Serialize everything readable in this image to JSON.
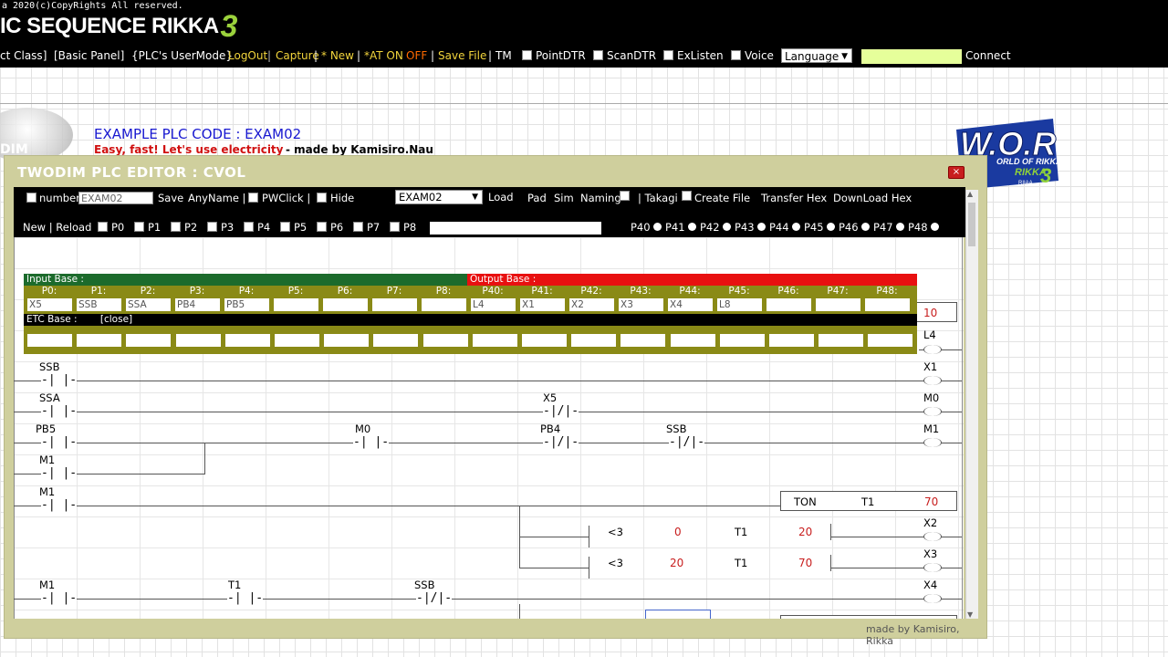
{
  "banner": {
    "copyright": "a 2020(c)CopyRights All reserved.",
    "logo_text": "IC SEQUENCE RIKKA",
    "logo_number": "3"
  },
  "menubar": {
    "items": [
      {
        "label": "ct Class]"
      },
      {
        "label": "[Basic Panel]"
      },
      {
        "label": "{PLC's UserMode}"
      },
      {
        "label": "LogOut"
      },
      {
        "label": "Capture"
      },
      {
        "label": "|"
      },
      {
        "label": "* New"
      },
      {
        "label": "|"
      },
      {
        "label": "*AT ON"
      },
      {
        "label": "OFF"
      },
      {
        "label": "|"
      },
      {
        "label": "Save File"
      },
      {
        "label": "|"
      },
      {
        "label": "TM"
      }
    ],
    "checks": [
      {
        "label": "PointDTR"
      },
      {
        "label": "ScanDTR"
      },
      {
        "label": "ExListen"
      },
      {
        "label": "Voice"
      }
    ],
    "language_value": "Language",
    "connect_label": "Connect"
  },
  "example": {
    "disc_text": "DIM",
    "title": "EXAMPLE PLC CODE : EXAM02",
    "subtitle": "Easy, fast! Let's use electricity",
    "author": "- made by Kamisiro.Nau"
  },
  "wor_logo": {
    "text": "W.O.R",
    "sub": "ORLD OF RIKKA",
    "brand": "RIKKA",
    "num": "3",
    "small": "RIIAA"
  },
  "editor": {
    "title": "TWODIM PLC EDITOR : CVOL",
    "close_icon": "×",
    "footer": "made by Kamisiro, Rikka",
    "toolbar": {
      "number_label": "number",
      "number_value": "EXAM02",
      "save": "Save",
      "anyname": "AnyName |",
      "pwclick": "PWClick |",
      "hide": "Hide",
      "file_value": "EXAM02",
      "load": "Load",
      "pad": "Pad",
      "sim": "Sim",
      "naming": "Naming",
      "takagi": "| Takagi",
      "create_file": "Create File",
      "transfer_hex": "Transfer Hex",
      "download_hex": "DownLoad Hex",
      "new_reload": "New | Reload",
      "p_checks": [
        "P0",
        "P1",
        "P2",
        "P3",
        "P4",
        "P5",
        "P6",
        "P7",
        "P8"
      ],
      "p_radios": [
        "P40",
        "P41",
        "P42",
        "P43",
        "P44",
        "P45",
        "P46",
        "P47",
        "P48"
      ]
    },
    "io": {
      "input_base": "Input Base :",
      "output_base": "Output Base :",
      "etc_base": "ETC Base :",
      "close": "[close]",
      "inputs": [
        {
          "port": "P0:",
          "value": "X5"
        },
        {
          "port": "P1:",
          "value": "SSB"
        },
        {
          "port": "P2:",
          "value": "SSA"
        },
        {
          "port": "P3:",
          "value": "PB4"
        },
        {
          "port": "P4:",
          "value": "PB5"
        },
        {
          "port": "P5:",
          "value": ""
        },
        {
          "port": "P6:",
          "value": ""
        },
        {
          "port": "P7:",
          "value": ""
        },
        {
          "port": "P8:",
          "value": ""
        }
      ],
      "outputs": [
        {
          "port": "P40:",
          "value": "L4"
        },
        {
          "port": "P41:",
          "value": "X1"
        },
        {
          "port": "P42:",
          "value": "X2"
        },
        {
          "port": "P43:",
          "value": "X3"
        },
        {
          "port": "P44:",
          "value": "X4"
        },
        {
          "port": "P45:",
          "value": "L8"
        },
        {
          "port": "P46:",
          "value": ""
        },
        {
          "port": "P47:",
          "value": ""
        },
        {
          "port": "P48:",
          "value": ""
        }
      ]
    },
    "ladder": {
      "top_box_value": "10",
      "labels": {
        "l4": "L4",
        "ssb1": "SSB",
        "x1": "X1",
        "ssa": "SSA",
        "x5": "X5",
        "m0_coil": "M0",
        "pb5": "PB5",
        "m0": "M0",
        "pb4": "PB4",
        "ssb2": "SSB",
        "m1_coil": "M1",
        "m1a": "M1",
        "m1b": "M1",
        "ton": "TON",
        "t1_ton": "T1",
        "ton_value": "70",
        "cmp1_op": "<3",
        "cmp1_a": "0",
        "cmp1_b": "T1",
        "cmp1_c": "20",
        "x2": "X2",
        "cmp2_op": "<3",
        "cmp2_a": "20",
        "cmp2_b": "T1",
        "cmp2_c": "70",
        "x3": "X3",
        "m1c": "M1",
        "t1c": "T1",
        "ssb3": "SSB",
        "x4": "X4"
      }
    }
  }
}
